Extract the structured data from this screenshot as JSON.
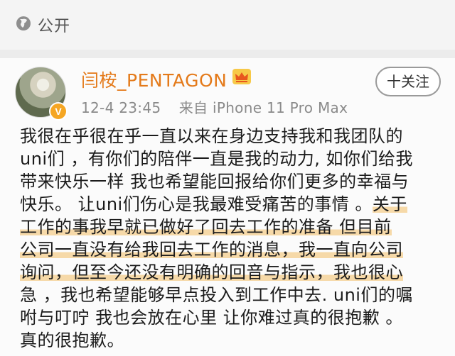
{
  "topbar": {
    "visibility_label": "公开"
  },
  "post": {
    "username": "闫桉_PENTAGON",
    "timestamp": "12-4 23:45",
    "source": "来自 iPhone 11 Pro Max",
    "follow_label": "十关注",
    "verified_badge": "V",
    "content_lines": [
      "我很在乎很在乎一直以来在身边支持我和我团队的",
      "uni们 ，有你们的陪伴一直是我的动力, 如你们给我",
      "带来快乐一样 我也希望能回报给你们更多的幸福与",
      "快乐。 让uni们伤心是我最难受痛苦的事情 。",
      "关于",
      "工作的事我早就已做好了回去工作的准备 但目前",
      "公司一直没有给我回去工作的消息，我一直向公司",
      "询问，但至今还没有明确的回音与指示，我也很心",
      "急 ，我也希望能够早点投入到工作中去. uni们的嘱",
      "咐与叮咛 我也会放在心里 让你难过真的很抱歉 。",
      "真的很抱歉。"
    ]
  },
  "colors": {
    "username": "#e47a1a",
    "highlight": "#f6d9a8",
    "meta": "#8a8a8a"
  },
  "icons": {
    "visibility": "globe-icon",
    "vip": "crown-icon",
    "avatar_badge": "verified-icon"
  }
}
